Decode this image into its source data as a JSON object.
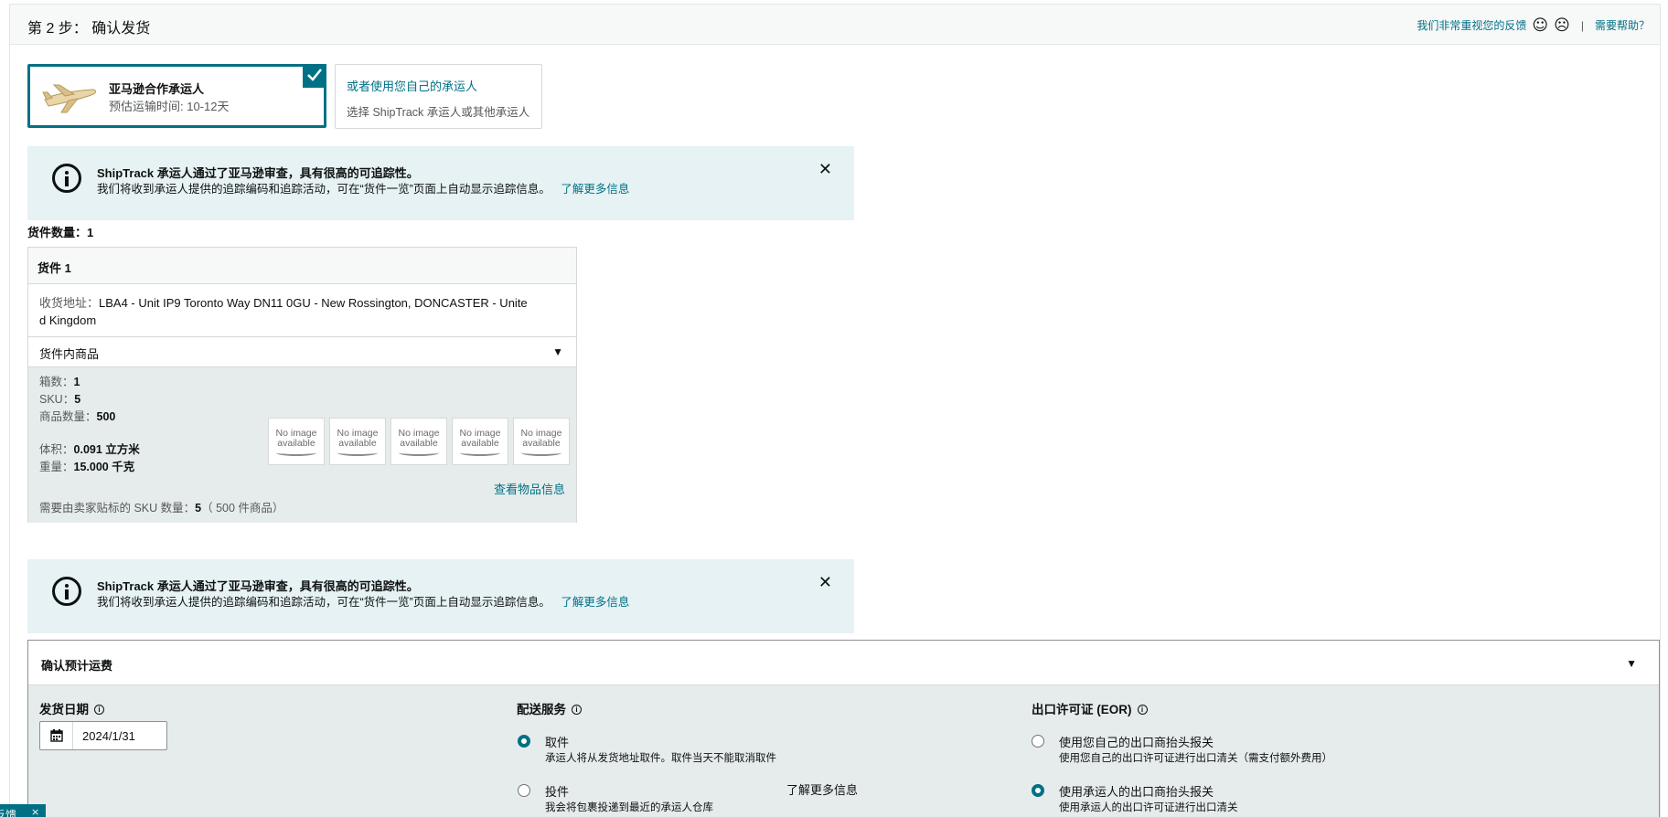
{
  "header": {
    "step_title": "第 2 步： 确认发货",
    "feedback_text": "我们非常重视您的反馈",
    "happy_face": "☺",
    "sad_face": "☹",
    "separator": "|",
    "help_link": "需要帮助？"
  },
  "carriers": {
    "amazon_partnered": {
      "title": "亚马逊合作承运人",
      "transit_time": "预估运输时间: 10-12天",
      "selected": true
    },
    "own_carrier": {
      "title": "或者使用您自己的承运人",
      "subtitle": "选择 ShipTrack 承运人或其他承运人"
    }
  },
  "alert_1": {
    "title": "ShipTrack 承运人通过了亚马逊审查，具有很高的可追踪性。",
    "body": "我们将收到承运人提供的追踪编码和追踪活动，可在“货件一览”页面上自动显示追踪信息。",
    "learn_more": "了解更多信息",
    "close": "✕"
  },
  "shipment_count_label": "货件数量：1",
  "shipment": {
    "title": "货件 1",
    "address_label": "收货地址：",
    "address_line1": "LBA4 - Unit IP9 Toronto Way DN11 0GU - New Rossington, DONCASTER - Unite",
    "address_line2": "d Kingdom",
    "items_header": "货件内商品",
    "caret": "▼",
    "boxes_label": "箱数：",
    "boxes_value": "1",
    "sku_label": "SKU：",
    "sku_value": "5",
    "units_label": "商品数量：",
    "units_value": "500",
    "volume_label": "体积：",
    "volume_value": "0.091 立方米",
    "weight_label": "重量：",
    "weight_value": "15.000 千克",
    "thumb_text_1": "No image",
    "thumb_text_2": "available",
    "view_items": "查看物品信息",
    "seller_label_prefix": "需要由卖家贴标的 SKU 数量：",
    "seller_label_count": "5",
    "seller_label_suffix": "（ 500 件商品）"
  },
  "alert_2": {
    "title": "ShipTrack 承运人通过了亚马逊审查，具有很高的可追踪性。",
    "body": "我们将收到承运人提供的追踪编码和追踪活动，可在“货件一览”页面上自动显示追踪信息。",
    "learn_more": "了解更多信息",
    "close": "✕"
  },
  "freight": {
    "title": "确认预计运费",
    "caret": "▼",
    "ship_date": {
      "label": "发货日期",
      "value": "2024/1/31"
    },
    "delivery_service": {
      "label": "配送服务",
      "learn_more": "了解更多信息",
      "options": [
        {
          "title": "取件",
          "desc": "承运人将从发货地址取件。取件当天不能取消取件",
          "selected": true
        },
        {
          "title": "投件",
          "desc": "我会将包裹投递到最近的承运人仓库",
          "selected": false
        }
      ]
    },
    "eor": {
      "label": "出口许可证 (EOR)",
      "options": [
        {
          "title": "使用您自己的出口商抬头报关",
          "desc": "使用您自己的出口许可证进行出口清关（需支付额外费用）",
          "selected": false
        },
        {
          "title": "使用承运人的出口商抬头报关",
          "desc": "使用承运人的出口许可证进行出口清关",
          "selected": true
        }
      ]
    }
  },
  "feedback_tab": {
    "label": "反馈",
    "close": "×"
  },
  "colors": {
    "accent": "#007185",
    "alert_bg": "#e6f2f4",
    "panel_bg": "#e6ecec"
  }
}
